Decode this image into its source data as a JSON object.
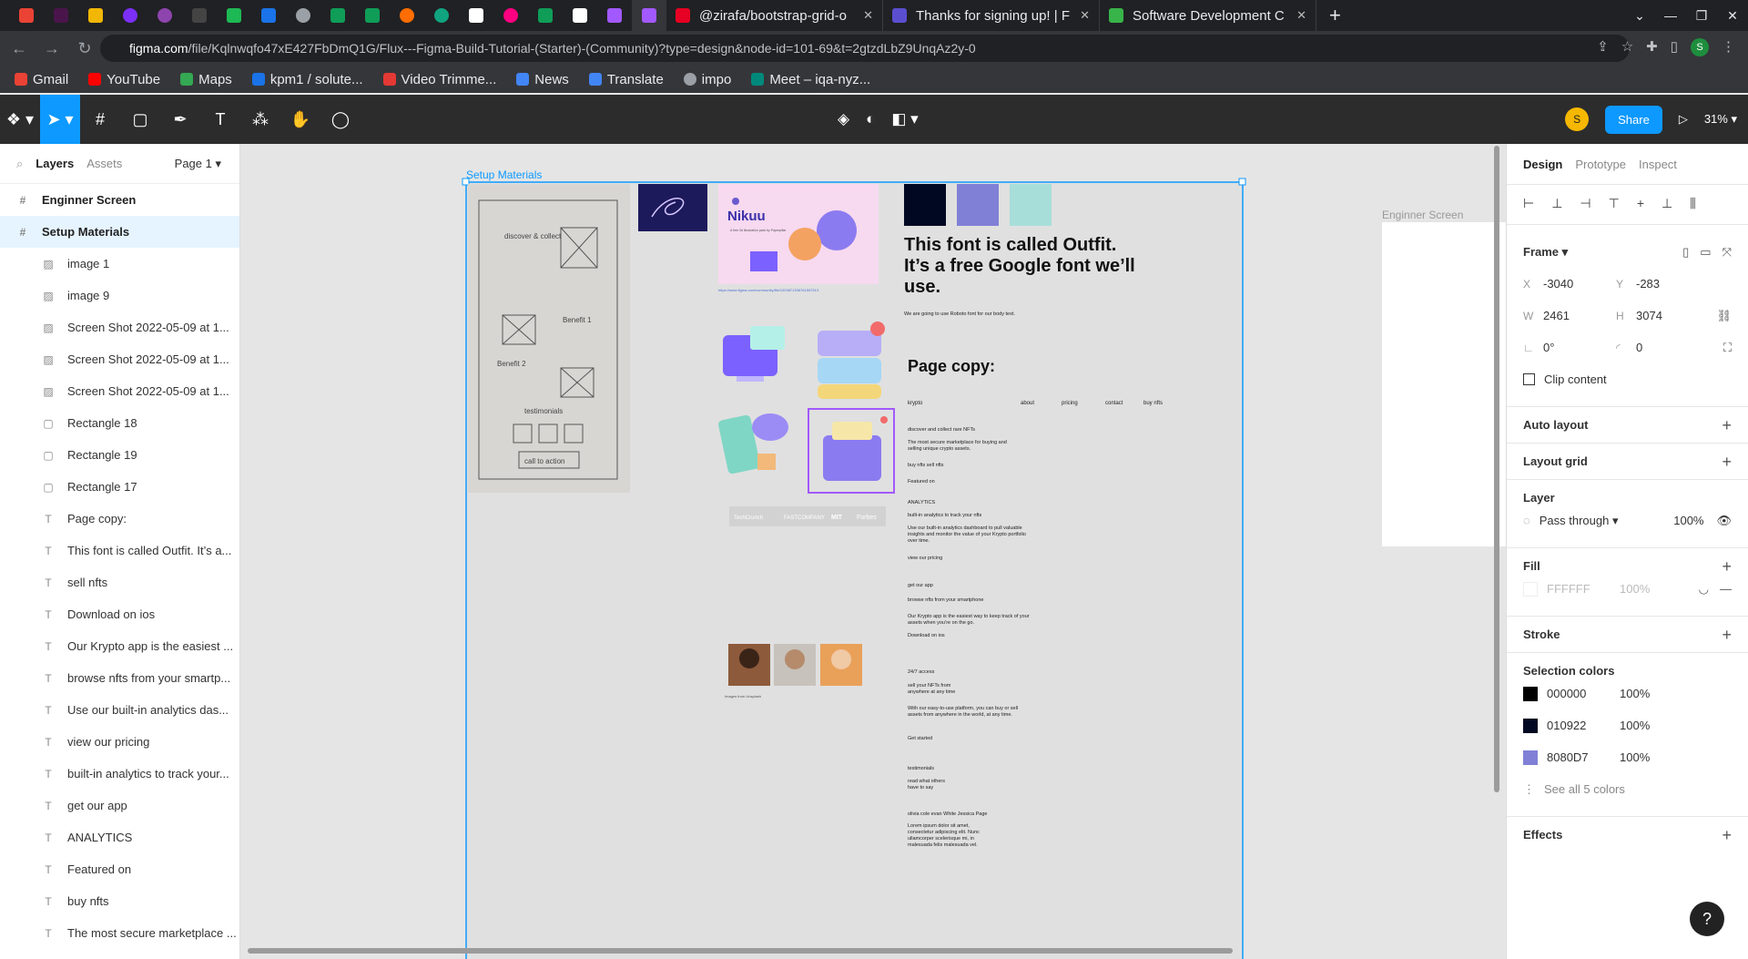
{
  "browser": {
    "tabs": [
      {
        "title": "@zirafa/bootstrap-grid-o",
        "color": "#e60023"
      },
      {
        "title": "Thanks for signing up! | F",
        "color": "#5b4fd0"
      },
      {
        "title": "Software Development C",
        "color": "#38b44a"
      }
    ],
    "url_host": "figma.com",
    "url_path": "/file/Kqlnwqfo47xE427FbDmQ1G/Flux---Figma-Build-Tutorial-(Starter)-(Community)?type=design&node-id=101-69&t=2gtzdLbZ9UnqAz2y-0",
    "profile_initial": "S",
    "bookmarks": [
      "Gmail",
      "YouTube",
      "Maps",
      "kpm1 / solute...",
      "Video Trimme...",
      "News",
      "Translate",
      "impo",
      "Meet – iqa-nyz..."
    ]
  },
  "toolbar": {
    "share_label": "Share",
    "zoom": "31%",
    "user_initial": "S"
  },
  "left_panel": {
    "tab_layers": "Layers",
    "tab_assets": "Assets",
    "page": "Page 1",
    "layers": [
      {
        "name": "Enginner Screen",
        "icon": "#",
        "level": "top"
      },
      {
        "name": "Setup Materials",
        "icon": "#",
        "level": "top-selected"
      },
      {
        "name": "image 1",
        "icon": "img",
        "level": "child"
      },
      {
        "name": "image 9",
        "icon": "img",
        "level": "child"
      },
      {
        "name": "Screen Shot 2022-05-09 at 1...",
        "icon": "img",
        "level": "child"
      },
      {
        "name": "Screen Shot 2022-05-09 at 1...",
        "icon": "img",
        "level": "child"
      },
      {
        "name": "Screen Shot 2022-05-09 at 1...",
        "icon": "img",
        "level": "child"
      },
      {
        "name": "Rectangle 18",
        "icon": "rect",
        "level": "child"
      },
      {
        "name": "Rectangle 19",
        "icon": "rect",
        "level": "child"
      },
      {
        "name": "Rectangle 17",
        "icon": "rect",
        "level": "child"
      },
      {
        "name": "Page copy:",
        "icon": "T",
        "level": "child"
      },
      {
        "name": "This font is called Outfit. It’s a...",
        "icon": "T",
        "level": "child"
      },
      {
        "name": "sell nfts",
        "icon": "T",
        "level": "child"
      },
      {
        "name": "Download on ios",
        "icon": "T",
        "level": "child"
      },
      {
        "name": "Our Krypto app is the easiest ...",
        "icon": "T",
        "level": "child"
      },
      {
        "name": "browse nfts from your smartp...",
        "icon": "T",
        "level": "child"
      },
      {
        "name": "Use our built-in analytics das...",
        "icon": "T",
        "level": "child"
      },
      {
        "name": "view our pricing",
        "icon": "T",
        "level": "child"
      },
      {
        "name": "built-in analytics to track your...",
        "icon": "T",
        "level": "child"
      },
      {
        "name": "get our app",
        "icon": "T",
        "level": "child"
      },
      {
        "name": "ANALYTICS",
        "icon": "T",
        "level": "child"
      },
      {
        "name": "Featured on",
        "icon": "T",
        "level": "child"
      },
      {
        "name": "buy nfts",
        "icon": "T",
        "level": "child"
      },
      {
        "name": "The most secure marketplace ...",
        "icon": "T",
        "level": "child"
      }
    ]
  },
  "canvas": {
    "frame_label": "Setup Materials",
    "other_frame_label": "Enginner Screen",
    "nikuu_title": "Nikuu",
    "nikuu_sub": "A free 3d illustration pack by Paperpillar",
    "nikuu_link": "https://www.figma.com/community/file/1003871336761597513",
    "swatches": [
      "#010922",
      "#8080D7",
      "#A8DEDA"
    ],
    "font_heading": "This font is called Outfit. It’s a free Google font we’ll use.",
    "font_sub": "We are going to use Roboto font for our body text.",
    "page_copy_title": "Page copy:",
    "nav": [
      "krypto",
      "about",
      "pricing",
      "contact",
      "buy nfts"
    ],
    "copy_blocks": [
      "discover and collect rare NFTs",
      "The most secure marketplace for buying and selling unique crypto assets.",
      "buy nfts      sell nfts",
      "Featured on",
      "ANALYTICS",
      "built-in analytics to track your nfts",
      "Use our built-in analytics dashboard to pull valuable insights and monitor the value of your Krypto portfolio over time.",
      "view our pricing",
      "get our app",
      "browse nfts from your smartphone",
      "Our Krypto app is the easiest way to keep track of your assets when you’re on the go.",
      "Download on ios",
      "24/7 access",
      "sell your NFTs from anywhere at any time",
      "With our easy-to-use platform, you can buy or sell assets from anywhere in the world, at any time.",
      "Get started",
      "testimonials",
      "read what others have to say",
      "olivia cole        evan White        Jessica Page",
      "Lorem ipsum dolor sit amet, consectetur adipiscing elit. Nunc ullamcorper scelerisque mi, in malesuada felis malesuada vel."
    ],
    "logos": [
      "TechCrunch",
      "FASTCOMPANY",
      "MIT",
      "Forbes"
    ],
    "images_from": "Images from Unsplash",
    "sketch_lines": [
      "discover & collect",
      "Benefit 1",
      "Benefit 2",
      "testimonials",
      "call to action"
    ]
  },
  "right_panel": {
    "tab_design": "Design",
    "tab_prototype": "Prototype",
    "tab_inspect": "Inspect",
    "frame_label": "Frame",
    "x": "-3040",
    "y": "-283",
    "w": "2461",
    "h": "3074",
    "rotation": "0°",
    "radius": "0",
    "clip_content": "Clip content",
    "auto_layout": "Auto layout",
    "layout_grid": "Layout grid",
    "layer_title": "Layer",
    "blend": "Pass through",
    "opacity": "100%",
    "fill_title": "Fill",
    "fill_hex": "FFFFFF",
    "fill_opacity": "100%",
    "stroke_title": "Stroke",
    "selection_colors_title": "Selection colors",
    "selection_colors": [
      {
        "hex": "000000",
        "color": "#000000",
        "opacity": "100%"
      },
      {
        "hex": "010922",
        "color": "#010922",
        "opacity": "100%"
      },
      {
        "hex": "8080D7",
        "color": "#8080D7",
        "opacity": "100%"
      }
    ],
    "see_all": "See all 5 colors",
    "effects_title": "Effects"
  }
}
